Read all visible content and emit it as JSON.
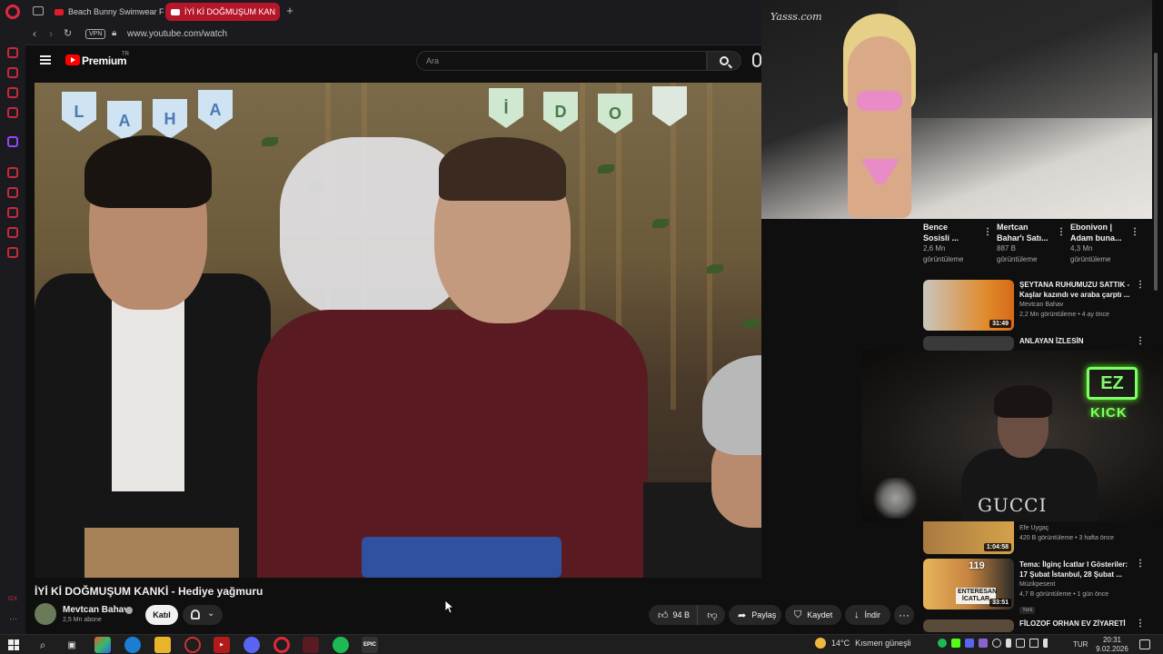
{
  "browser": {
    "tabs": [
      {
        "label": "Beach Bunny Swimwear F",
        "active": false
      },
      {
        "label": "İYİ Kİ DOĞMUŞUM KAN",
        "active": true
      }
    ],
    "url": "www.youtube.com/watch",
    "vpn_label": "VPN"
  },
  "youtube": {
    "brand": "Premium",
    "brand_suffix": "TR",
    "search_placeholder": "Ara"
  },
  "video": {
    "title": "İYİ Kİ DOĞMUŞUM KANKİ - Hediye yağmuru",
    "pennant_letters": [
      "L",
      "A",
      "H",
      "A",
      "İ",
      "D",
      "O"
    ],
    "channel": {
      "name": "Mevtcan Bahav",
      "subscribers": "2,5 Mn abone",
      "join_label": "Katıl"
    },
    "actions": {
      "likes": "94 B",
      "share": "Paylaş",
      "save": "Kaydet",
      "download": "İndir"
    }
  },
  "overlay": {
    "watermark": "Yasss.com"
  },
  "shorts": [
    {
      "title_line1": "Bence",
      "title_line2": "Sosisli ...",
      "views_line1": "2,6 Mn",
      "views_line2": "görüntüleme"
    },
    {
      "title_line1": "Mertcan",
      "title_line2": "Bahar'ı Satı...",
      "views_line1": "887 B",
      "views_line2": "görüntüleme"
    },
    {
      "title_line1": "Ebonivon |",
      "title_line2": "Adam buna...",
      "views_line1": "4,3 Mn",
      "views_line2": "görüntüleme"
    }
  ],
  "recommendations": [
    {
      "title_line1": "ŞEYTANA RUHUMUZU SATTIK -",
      "title_line2": "Kaşlar kazındı ve araba çarptı ...",
      "channel": "Mevtcan Bahav",
      "meta": "2,2 Mn görüntüleme • 4 ay önce",
      "duration": "31:49"
    },
    {
      "title_line1": "ANLAYAN İZLESİN",
      "title_line2": "",
      "channel": "",
      "meta": "",
      "duration": ""
    },
    {
      "title_line1": "",
      "title_line2": "",
      "channel": "Efe Uygaç",
      "meta": "420 B görüntüleme • 3 hafta önce",
      "duration": "1:04:58"
    },
    {
      "title_line1": "Tema: İlginç İcatlar I Gösteriler:",
      "title_line2": "17 Şubat İstanbul, 28 Şubat ...",
      "channel": "Müzikpesent",
      "meta": "4,7 B görüntüleme • 1 gün önce",
      "badge": "Yeni",
      "duration": "33:51",
      "thumb_text": "ENTERESAN İCATLAR",
      "thumb_number": "119"
    },
    {
      "title_line1": "FİLOZOF ORHAN EV ZİYARETİ",
      "title_line2": "",
      "channel": "",
      "meta": "",
      "duration": ""
    }
  ],
  "webcam": {
    "shirt_text": "GUCCI",
    "logo_text": "EZ",
    "platform": "KICK"
  },
  "taskbar": {
    "weather_temp": "14°C",
    "weather_text": "Kısmen güneşli",
    "lang": "TUR",
    "time": "20:31",
    "date": "9.02.2026"
  },
  "colors": {
    "youtube_red": "#ff0000",
    "opera_red": "#e0293b",
    "active_tab": "#b5162a",
    "kick_green": "#53fc18"
  }
}
